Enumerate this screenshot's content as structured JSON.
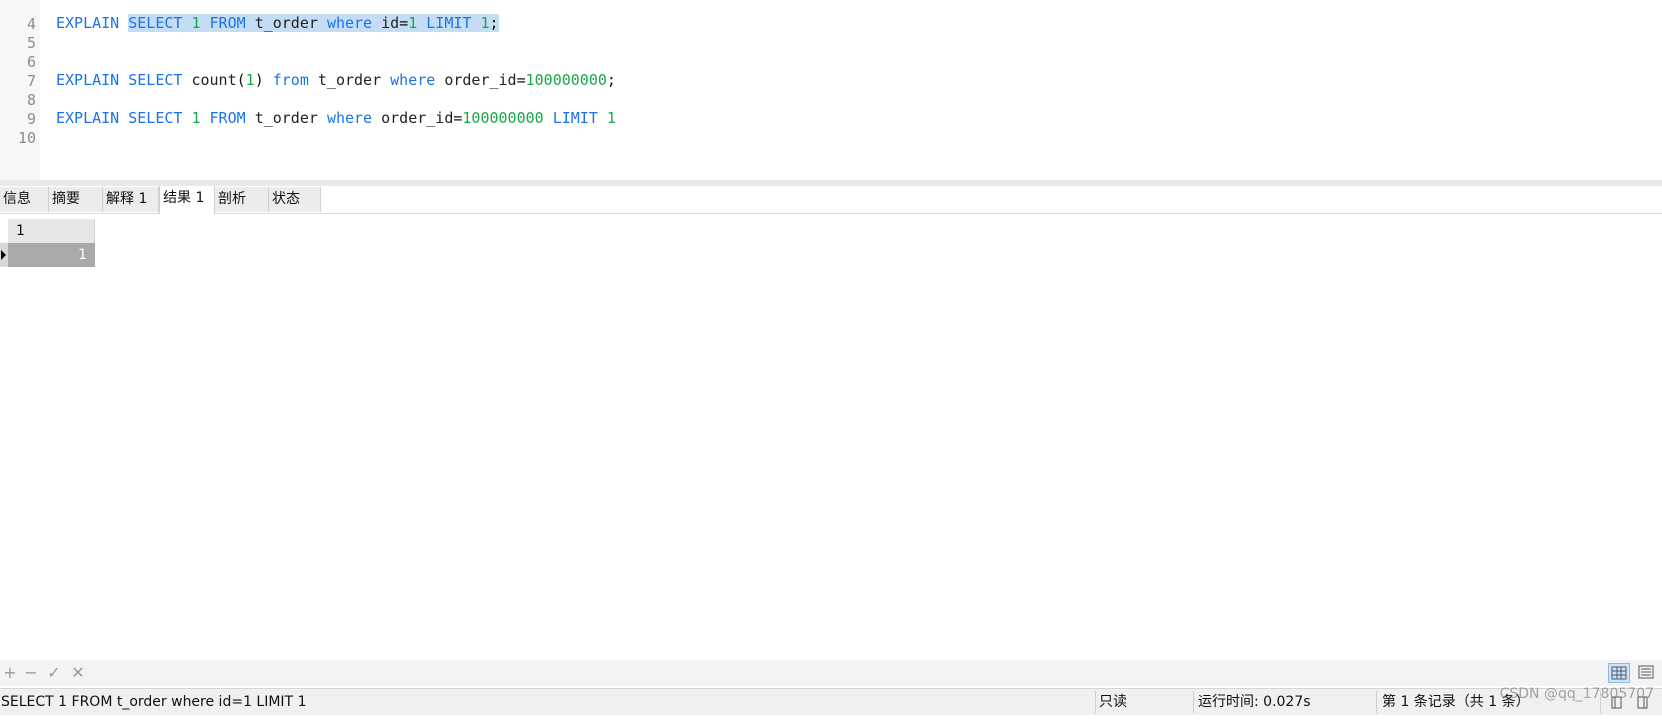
{
  "editor": {
    "lines": [
      {
        "num": "4",
        "code": ""
      },
      {
        "num": "5",
        "code": "EXPLAIN SELECT 1 FROM t_order where id=1 LIMIT 1;"
      },
      {
        "num": "6",
        "code": ""
      },
      {
        "num": "7",
        "code": ""
      },
      {
        "num": "8",
        "code": "EXPLAIN SELECT count(1) from t_order where order_id=100000000;"
      },
      {
        "num": "9",
        "code": ""
      },
      {
        "num": "10",
        "code": "EXPLAIN SELECT 1 FROM t_order where order_id=100000000 LIMIT 1"
      }
    ],
    "selected_text": "SELECT 1 FROM t_order where id=1 LIMIT 1;"
  },
  "tabs": [
    {
      "label": "信息"
    },
    {
      "label": "摘要"
    },
    {
      "label": "解释 1"
    },
    {
      "label": "结果 1",
      "active": true
    },
    {
      "label": "剖析"
    },
    {
      "label": "状态"
    }
  ],
  "result": {
    "columns": [
      "1"
    ],
    "rows": [
      [
        "1"
      ]
    ]
  },
  "toolbar": {
    "buttons": [
      {
        "name": "add",
        "glyph": "+"
      },
      {
        "name": "remove",
        "glyph": "−"
      },
      {
        "name": "apply",
        "glyph": "✓"
      },
      {
        "name": "discard",
        "glyph": "✕"
      }
    ],
    "view_modes": [
      "grid-view",
      "form-view"
    ],
    "active_view": "grid-view"
  },
  "status": {
    "query": "SELECT 1 FROM t_order where id=1 LIMIT 1",
    "mode": "只读",
    "runtime": "运行时间: 0.027s",
    "records": "第 1 条记录（共 1 条）"
  },
  "watermark": "CSDN @qq_17805707",
  "colors": {
    "keyword": "#1a73e8",
    "number": "#18a84a",
    "selection": "#c5dcf5",
    "active_view_button": "#cfe3f6",
    "selected_cell": "#a9a9a9"
  }
}
